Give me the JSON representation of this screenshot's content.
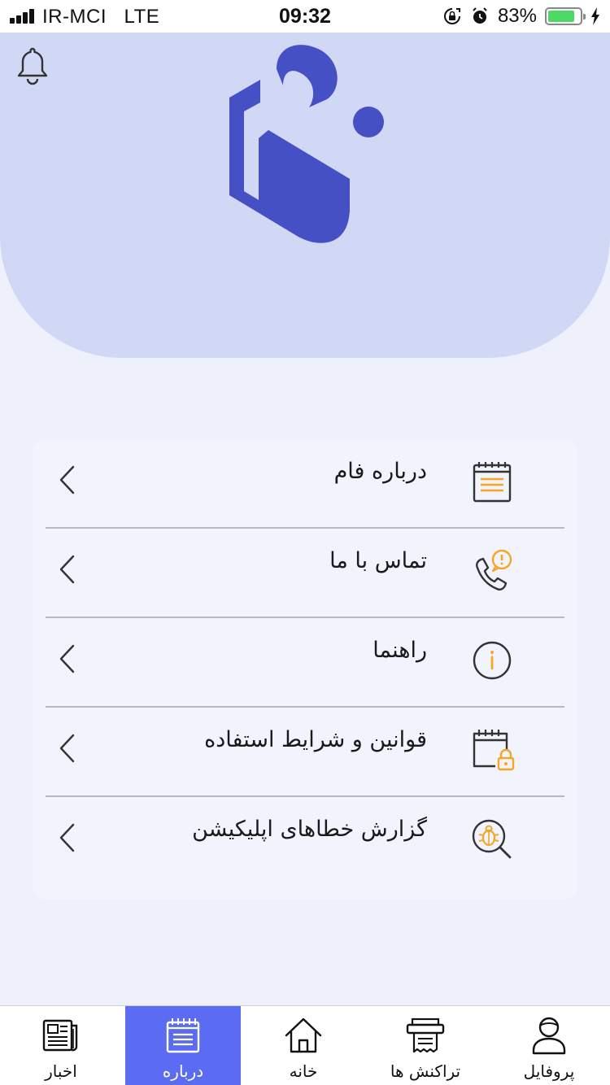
{
  "status_bar": {
    "carrier": "IR-MCI",
    "network": "LTE",
    "time": "09:32",
    "battery": "83%",
    "battery_level": 0.83
  },
  "colors": {
    "brand": "#4450c4",
    "header_bg": "#d0d8f5",
    "accent_orange": "#f5a623",
    "active_tab": "#5b6cf2"
  },
  "header": {
    "bell_icon": "bell-icon",
    "logo": "fam-logo"
  },
  "menu": {
    "items": [
      {
        "label": "درباره فام",
        "icon": "notepad-icon"
      },
      {
        "label": "تماس با ما",
        "icon": "phone-alert-icon"
      },
      {
        "label": "راهنما",
        "icon": "info-icon"
      },
      {
        "label": "قوانین و شرایط استفاده",
        "icon": "document-lock-icon"
      },
      {
        "label": "گزارش خطاهای اپلیکیشن",
        "icon": "bug-search-icon"
      }
    ]
  },
  "bottom_nav": {
    "items": [
      {
        "label": "اخبار",
        "icon": "newspaper-icon",
        "active": false
      },
      {
        "label": "درباره",
        "icon": "notepad-icon",
        "active": true
      },
      {
        "label": "خانه",
        "icon": "home-icon",
        "active": false
      },
      {
        "label": "تراکنش ها",
        "icon": "receipt-printer-icon",
        "active": false
      },
      {
        "label": "پروفایل",
        "icon": "user-icon",
        "active": false
      }
    ]
  }
}
